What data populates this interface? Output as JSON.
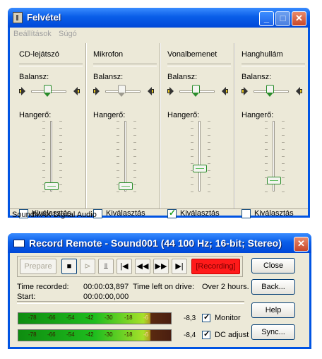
{
  "win1": {
    "title": "Felvétel",
    "menu": [
      "Beállítások",
      "Súgó"
    ],
    "balance_label": "Balansz:",
    "volume_label": "Hangerő:",
    "select_label": "Kiválasztás",
    "channels": [
      {
        "name": "CD-lejátszó",
        "volume_level": 0.08,
        "balance": 0.5,
        "selected": false
      },
      {
        "name": "Mikrofon",
        "volume_level": 0.08,
        "balance": 0.5,
        "selected": false
      },
      {
        "name": "Vonalbemenet",
        "volume_level": 0.33,
        "balance": 0.5,
        "selected": true
      },
      {
        "name": "Hanghullám",
        "volume_level": 0.16,
        "balance": 0.5,
        "selected": false
      }
    ],
    "status": "SoundMAX Digital Audio"
  },
  "win2": {
    "title": "Record Remote - Sound001 (44 100 Hz; 16-bit; Stereo)",
    "prepare": "Prepare",
    "recording": "[Recording]",
    "transport_icons": [
      "stop-icon",
      "cue-icon",
      "marker-icon",
      "go-start-icon",
      "rewind-icon",
      "fast-forward-icon",
      "go-end-icon"
    ],
    "transport_glyphs": [
      "■",
      "⊳",
      "⫫",
      "|◀",
      "◀◀",
      "▶▶",
      "▶|"
    ],
    "time_recorded_label": "Time recorded:",
    "time_recorded": "00:00:03,897",
    "time_left_label": "Time left on drive:",
    "time_left": "Over 2 hours.",
    "start_label": "Start:",
    "start": "00:00:00,000",
    "meter_ticks": [
      "-78",
      "-66",
      "-54",
      "-42",
      "-30",
      "-18",
      "-6"
    ],
    "meters": [
      {
        "peak": "-8,3",
        "option": "Monitor",
        "checked": true
      },
      {
        "peak": "-8,4",
        "option": "DC adjust",
        "checked": true
      }
    ],
    "buttons": [
      "Close",
      "Back...",
      "Help",
      "Sync..."
    ]
  }
}
